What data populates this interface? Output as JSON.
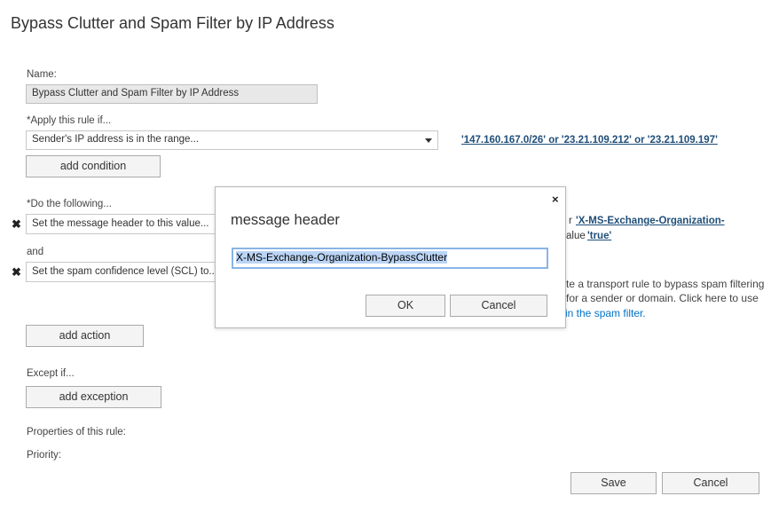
{
  "page": {
    "title": "Bypass Clutter and Spam Filter by IP Address"
  },
  "form": {
    "name_label": "Name:",
    "name_value": "Bypass Clutter and Spam Filter by IP Address",
    "apply_label": "*Apply this rule if...",
    "apply_condition": "Sender's IP address is in the range...",
    "apply_condition_link": "'147.160.167.0/26' or '23.21.109.212' or '23.21.109.197'",
    "add_condition": "add condition",
    "do_label": "*Do the following...",
    "action1": "Set the message header to this value...",
    "action1_link_prefix": "r ",
    "action1_link": "'X-MS-Exchange-Organization-",
    "action1_value_prefix": "alue ",
    "action1_value_link": "'true'",
    "and_label": "and",
    "action2": "Set the spam confidence level (SCL) to...",
    "info_line1": "te a transport rule to bypass spam filtering",
    "info_line2": " for a sender or domain. Click here to use",
    "info_link": " in the spam filter.",
    "add_action": "add action",
    "except_label": "Except if...",
    "add_exception": "add exception",
    "properties_label": "Properties of this rule:",
    "priority_label": "Priority:"
  },
  "footer": {
    "save": "Save",
    "cancel": "Cancel"
  },
  "dialog": {
    "title": "message header",
    "close": "×",
    "input_value": "X-MS-Exchange-Organization-BypassClutter",
    "ok": "OK",
    "cancel": "Cancel"
  },
  "icons": {
    "remove": "remove-icon",
    "close": "close-icon",
    "dropdown": "chevron-down-icon"
  },
  "colors": {
    "link": "#1f4e79",
    "accent_link": "#0072c6",
    "selection": "#bad4f5",
    "focus_border": "#8ab4e6"
  }
}
